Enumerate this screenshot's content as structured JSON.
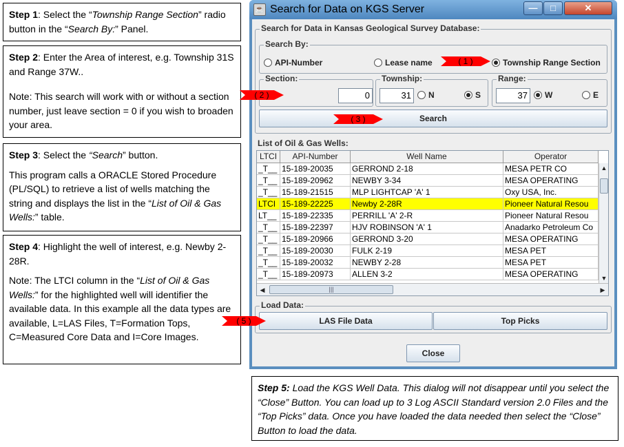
{
  "steps": {
    "step1": {
      "label": "Step 1",
      "t1": ": Select the “",
      "i1": "Township Range Section",
      "t2": "” radio button in the “",
      "i2": "Search By:",
      "t3": "” Panel."
    },
    "step2": {
      "label": "Step 2",
      "t1": ": Enter the Area of interest, e.g. Township 31S and Range 37W..",
      "note": "Note: This search will work with or without a section number, just leave section = 0 if you wish to broaden your area."
    },
    "step3": {
      "label": "Step 3",
      "t1": ": Select the ",
      "i1": "“Search",
      "t2": "” button.",
      "p2a": "This program calls a ORACLE Stored Procedure (PL/SQL) to retrieve a list of wells matching the string and displays the list in the “",
      "p2i": "List of Oil & Gas Wells:",
      "p2b": "” table."
    },
    "step4": {
      "label": "Step 4",
      "t1": ": Highlight the well of interest, e.g. Newby 2-28R.",
      "p2a": "Note: The LTCI column in the “",
      "p2i": "List of Oil & Gas Wells:",
      "p2b": "” for the highlighted well will identifier the available data. In this example all the data types are available, L=LAS Files, T=Formation Tops, C=Measured Core Data and I=Core Images."
    },
    "step5": {
      "label": "Step 5:",
      "text": " Load the KGS Well Data.  This dialog will not disappear until you select the “Close” Button.  You can load up to 3 Log ASCII Standard version 2.0 Files and the “Top Picks” data.  Once you have loaded the data needed then select the “Close” Button to load the data."
    }
  },
  "window": {
    "title": "Search for Data on KGS Server",
    "main_group": "Search for Data in Kansas Geological Survey Database:",
    "search_by": {
      "label": "Search By:",
      "options": [
        "API-Number",
        "Lease name",
        "Township Range Section"
      ],
      "selected": "Township Range Section"
    },
    "section": {
      "label": "Section:",
      "value": "0"
    },
    "township": {
      "label": "Township:",
      "value": "31",
      "dir_n": "N",
      "dir_s": "S",
      "selected": "S"
    },
    "range": {
      "label": "Range:",
      "value": "37",
      "dir_w": "W",
      "dir_e": "E",
      "selected": "W"
    },
    "search_button": "Search",
    "wells_group": "List of Oil & Gas Wells:",
    "columns": [
      "LTCI",
      "API-Number",
      "Well Name",
      "Operator"
    ],
    "rows": [
      [
        "_T__",
        "15-189-20035",
        "GERROND 2-18",
        "MESA PETR CO"
      ],
      [
        "_T__",
        "15-189-20962",
        "NEWBY 3-34",
        "MESA OPERATING"
      ],
      [
        "_T__",
        "15-189-21515",
        "MLP LIGHTCAP 'A' 1",
        "Oxy USA, Inc."
      ],
      [
        "LTCI",
        "15-189-22225",
        "Newby 2-28R",
        "Pioneer Natural Resou"
      ],
      [
        "LT__",
        "15-189-22335",
        "PERRILL 'A' 2-R",
        "Pioneer Natural Resou"
      ],
      [
        "_T__",
        "15-189-22397",
        "HJV ROBINSON 'A' 1",
        "Anadarko Petroleum Co"
      ],
      [
        "_T__",
        "15-189-20966",
        "GERROND 3-20",
        "MESA OPERATING"
      ],
      [
        "_T__",
        "15-189-20030",
        "FULK 2-19",
        "MESA PET"
      ],
      [
        "_T__",
        "15-189-20032",
        "NEWBY 2-28",
        "MESA PET"
      ],
      [
        "_T__",
        "15-189-20973",
        "ALLEN 3-2",
        "MESA OPERATING"
      ]
    ],
    "selected_row": 3,
    "load_group": "Load Data:",
    "las_button": "LAS File Data",
    "tops_button": "Top Picks",
    "close_button": "Close"
  },
  "arrows": {
    "a1": "( 1 )",
    "a2": "( 2 )",
    "a3": "( 3 )",
    "a5": "( 5 )"
  },
  "colors": {
    "highlight": "#ffff00",
    "arrow": "#ff0000",
    "titlebar": "#5b8fbf"
  }
}
